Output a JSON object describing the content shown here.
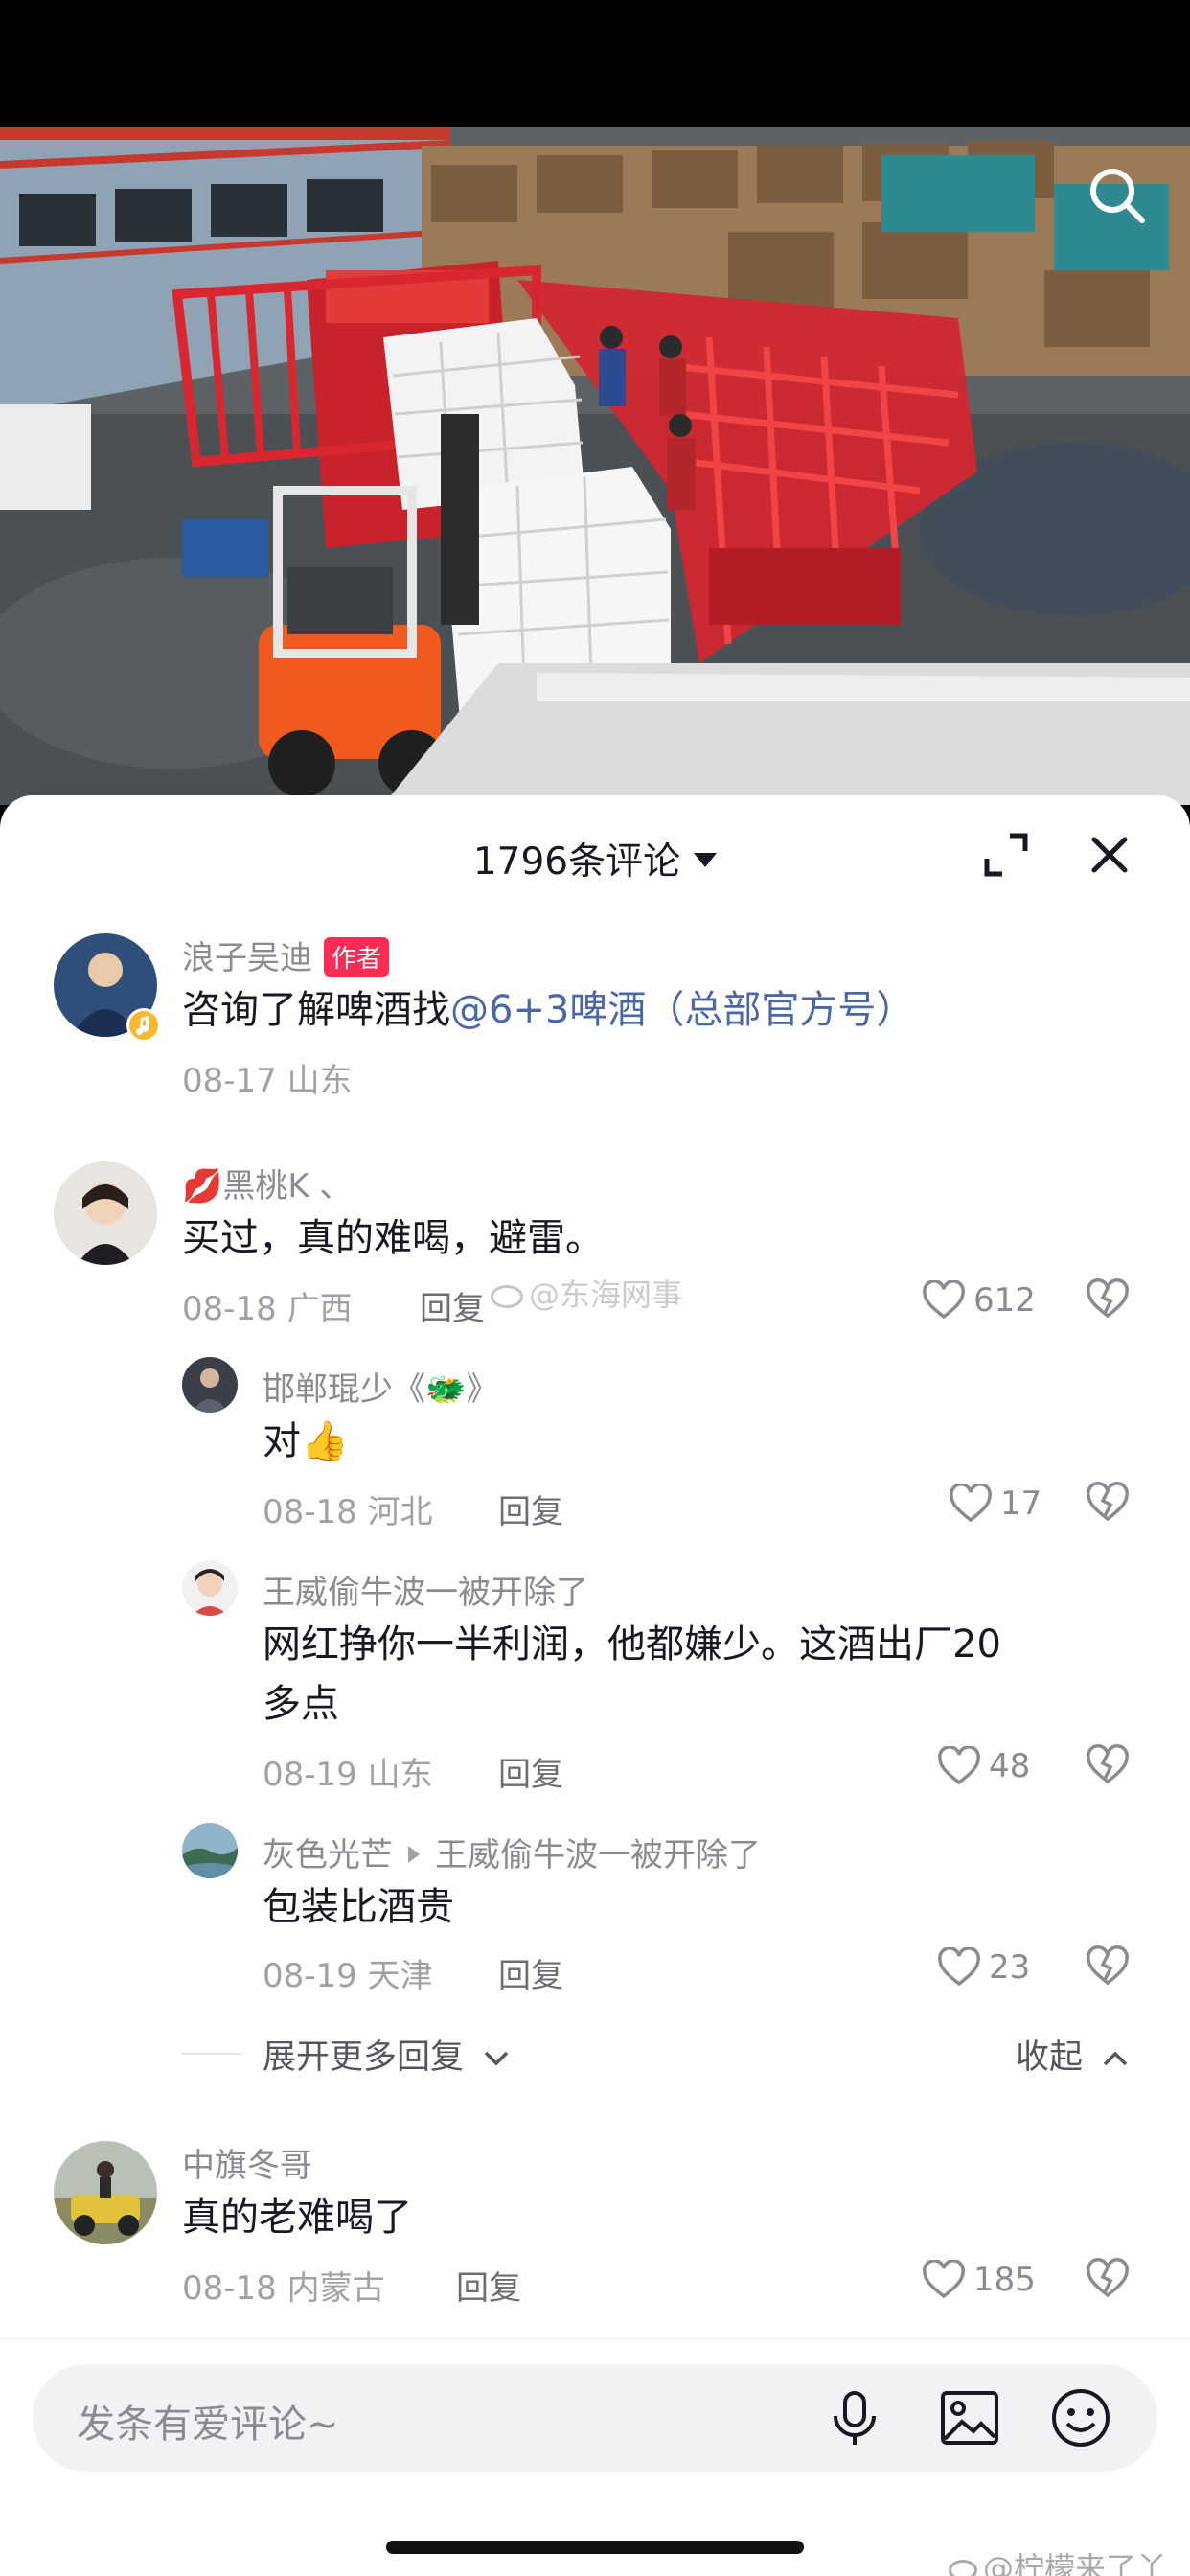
{
  "header": {
    "comment_count": "1796条评论"
  },
  "comments": [
    {
      "username": "浪子吴迪",
      "badge": "作者",
      "text_prefix": "咨询了解啤酒找",
      "mention": "@6+3啤酒（总部官方号）",
      "date": "08-17",
      "location": "山东"
    },
    {
      "username": "💋黑桃K 、",
      "text": "买过，真的难喝，避雷。",
      "date": "08-18",
      "location": "广西",
      "reply_label": "回复",
      "likes": "612"
    },
    {
      "username": "邯郸琨少《🐲》",
      "text": "对👍",
      "date": "08-18",
      "location": "河北",
      "reply_label": "回复",
      "likes": "17"
    },
    {
      "username": "王威偷牛波一被开除了",
      "text_line1": "网红挣你一半利润，他都嫌少。这酒出厂20",
      "text_line2": "多点",
      "date": "08-19",
      "location": "山东",
      "reply_label": "回复",
      "likes": "48"
    },
    {
      "username": "灰色光芒",
      "reply_to": "王威偷牛波一被开除了",
      "text": "包装比酒贵",
      "date": "08-19",
      "location": "天津",
      "reply_label": "回复",
      "likes": "23"
    },
    {
      "username": "中旗冬哥",
      "text": "真的老难喝了",
      "date": "08-18",
      "location": "内蒙古",
      "reply_label": "回复",
      "likes": "185"
    }
  ],
  "thread": {
    "expand_label": "展开更多回复",
    "collapse_label": "收起"
  },
  "input": {
    "placeholder": "发条有爱评论~"
  },
  "watermarks": {
    "center": "@东海网事",
    "bottom": "@柠檬来了丫"
  },
  "icons": {
    "video_search": "search-icon",
    "fullscreen": "expand-icon",
    "close": "close-icon",
    "like": "heart-icon",
    "dislike": "broken-heart-icon",
    "mic": "microphone-icon",
    "image": "image-icon",
    "emoji": "smiley-icon"
  }
}
